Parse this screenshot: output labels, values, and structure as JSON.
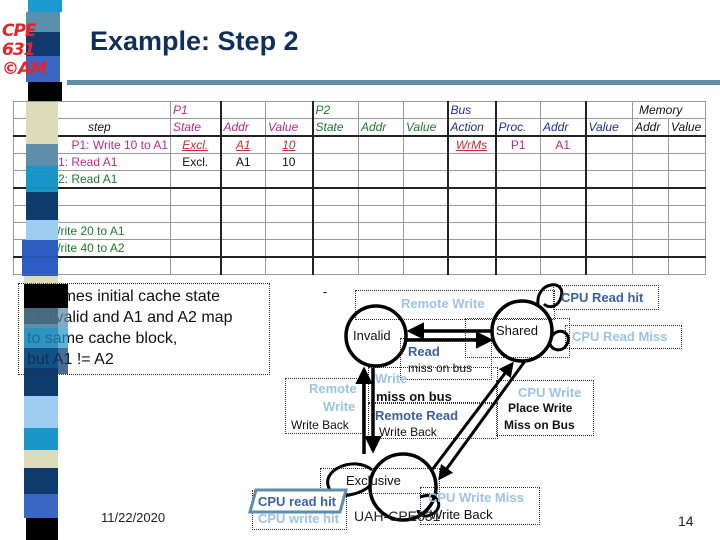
{
  "logo": {
    "lines": [
      "CPE",
      "631",
      "©AM"
    ]
  },
  "title": "Example: Step 2",
  "table": {
    "group_headers": [
      "",
      "P1",
      "",
      "",
      "P2",
      "",
      "",
      "Bus",
      "",
      "",
      "",
      "Memory",
      ""
    ],
    "column_headers": [
      "step",
      "State",
      "Addr",
      "Value",
      "State",
      "Addr",
      "Value",
      "Action",
      "Proc.",
      "Addr",
      "Value",
      "Addr",
      "Value"
    ],
    "rows": [
      {
        "step": "P1: Write 10 to A1",
        "cells": [
          "Excl.",
          "A1",
          "10",
          "",
          "",
          "",
          "WrMs",
          "P1",
          "A1",
          "",
          "",
          ""
        ]
      },
      {
        "step": "P1: Read A1",
        "cells": [
          "Excl.",
          "A1",
          "10",
          "",
          "",
          "",
          "",
          "",
          "",
          "",
          "",
          ""
        ]
      },
      {
        "step": "P2: Read A1",
        "cells": [
          "",
          "",
          "",
          "",
          "",
          "",
          "",
          "",
          "",
          "",
          "",
          ""
        ]
      },
      {
        "step": "",
        "cells": [
          "",
          "",
          "",
          "",
          "",
          "",
          "",
          "",
          "",
          "",
          "",
          ""
        ]
      },
      {
        "step": "",
        "cells": [
          "",
          "",
          "",
          "",
          "",
          "",
          "",
          "",
          "",
          "",
          "",
          ""
        ]
      },
      {
        "step": "P2: Write 20 to A1",
        "cells": [
          "",
          "",
          "",
          "",
          "",
          "",
          "",
          "",
          "",
          "",
          "",
          ""
        ]
      },
      {
        "step": "P2: Write 40 to A2",
        "cells": [
          "",
          "",
          "",
          "",
          "",
          "",
          "",
          "",
          "",
          "",
          "",
          ""
        ]
      },
      {
        "step": "",
        "cells": [
          "",
          "",
          "",
          "",
          "",
          "",
          "",
          "",
          "",
          "",
          "",
          ""
        ]
      }
    ]
  },
  "note": {
    "lines": [
      "Assumes initial cache state",
      "is invalid and A1 and A2 map",
      "to same cache block,",
      "but A1 !=  A2"
    ]
  },
  "diagram": {
    "states": {
      "invalid": "Invalid",
      "shared": "Shared",
      "exclusive": "Exclusive"
    },
    "labels": {
      "remote_write_top": "Remote Write",
      "cpu_read_hit": "CPU Read hit",
      "cpu_read_miss": "CPU Read Miss",
      "read": "Read",
      "read_miss_on_bus": "miss on bus",
      "write": "Write",
      "write_miss_on_bus": "miss on bus",
      "remote_read": "Remote Read",
      "remote_read_write_back": "Write Back",
      "remote_write_left_1": "Remote",
      "remote_write_left_2": "Write",
      "remote_write_left_wb": "Write Back",
      "cpu_write": "CPU Write",
      "place_write": "Place Write",
      "miss_on_bus": "Miss on Bus",
      "cpu_read_hit_excl": "CPU read hit",
      "cpu_write_hit_excl": "CPU write hit",
      "cpu_write_miss": "CPU Write Miss",
      "cpu_write_miss_wb": "Write Back"
    },
    "dash": "-"
  },
  "footer": {
    "date": "11/22/2020",
    "center": "UAH-CPE631",
    "page": "14"
  }
}
